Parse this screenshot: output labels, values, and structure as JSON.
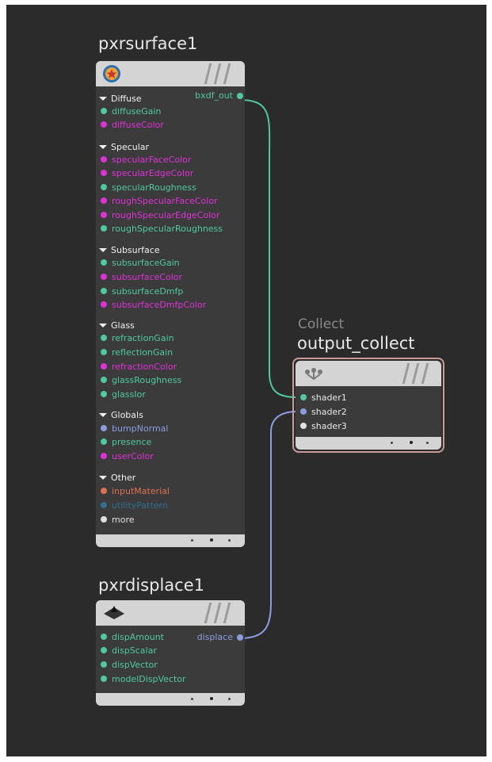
{
  "colors": {
    "background": "#2b2b2b",
    "node_body": "#3b3b3b",
    "node_header": "#d4d4d4",
    "float_param": "#4fc9a0",
    "color_param": "#e030d8",
    "vector_param": "#8c9cde",
    "material_param": "#e07050",
    "pattern_param": "#2f6f8f",
    "bxdf_wire": "#4fc9a0",
    "displace_wire": "#8c9cde",
    "collect_border": "#c99a98"
  },
  "pxrsurface": {
    "title": "pxrsurface1",
    "icon": "pxr-star-icon",
    "output": {
      "label": "bxdf_out",
      "type": "float"
    },
    "groups": [
      {
        "label": "Diffuse",
        "params": [
          {
            "label": "diffuseGain",
            "type": "float"
          },
          {
            "label": "diffuseColor",
            "type": "color"
          }
        ]
      },
      {
        "label": "Specular",
        "params": [
          {
            "label": "specularFaceColor",
            "type": "color"
          },
          {
            "label": "specularEdgeColor",
            "type": "color"
          },
          {
            "label": "specularRoughness",
            "type": "float"
          },
          {
            "label": "roughSpecularFaceColor",
            "type": "color"
          },
          {
            "label": "roughSpecularEdgeColor",
            "type": "color"
          },
          {
            "label": "roughSpecularRoughness",
            "type": "float"
          }
        ]
      },
      {
        "label": "Subsurface",
        "params": [
          {
            "label": "subsurfaceGain",
            "type": "float"
          },
          {
            "label": "subsurfaceColor",
            "type": "color"
          },
          {
            "label": "subsurfaceDmfp",
            "type": "float"
          },
          {
            "label": "subsurfaceDmfpColor",
            "type": "color"
          }
        ]
      },
      {
        "label": "Glass",
        "params": [
          {
            "label": "refractionGain",
            "type": "float"
          },
          {
            "label": "reflectionGain",
            "type": "float"
          },
          {
            "label": "refractionColor",
            "type": "color"
          },
          {
            "label": "glassRoughness",
            "type": "float"
          },
          {
            "label": "glassIor",
            "type": "float"
          }
        ]
      },
      {
        "label": "Globals",
        "params": [
          {
            "label": "bumpNormal",
            "type": "vector"
          },
          {
            "label": "presence",
            "type": "float"
          },
          {
            "label": "userColor",
            "type": "color"
          }
        ]
      },
      {
        "label": "Other",
        "params": [
          {
            "label": "inputMaterial",
            "type": "material"
          },
          {
            "label": "utilityPattern",
            "type": "pattern"
          },
          {
            "label": "more",
            "type": "more"
          }
        ]
      }
    ]
  },
  "collect": {
    "subtitle": "Collect",
    "title": "output_collect",
    "icon": "collect-icon",
    "inputs": [
      {
        "label": "shader1",
        "type": "float"
      },
      {
        "label": "shader2",
        "type": "vector"
      },
      {
        "label": "shader3",
        "type": "more"
      }
    ]
  },
  "pxrdisplace": {
    "title": "pxrdisplace1",
    "icon": "displace-icon",
    "output": {
      "label": "displace",
      "type": "vector"
    },
    "params": [
      {
        "label": "dispAmount",
        "type": "float"
      },
      {
        "label": "dispScalar",
        "type": "float"
      },
      {
        "label": "dispVector",
        "type": "float"
      },
      {
        "label": "modelDispVector",
        "type": "float"
      }
    ]
  }
}
